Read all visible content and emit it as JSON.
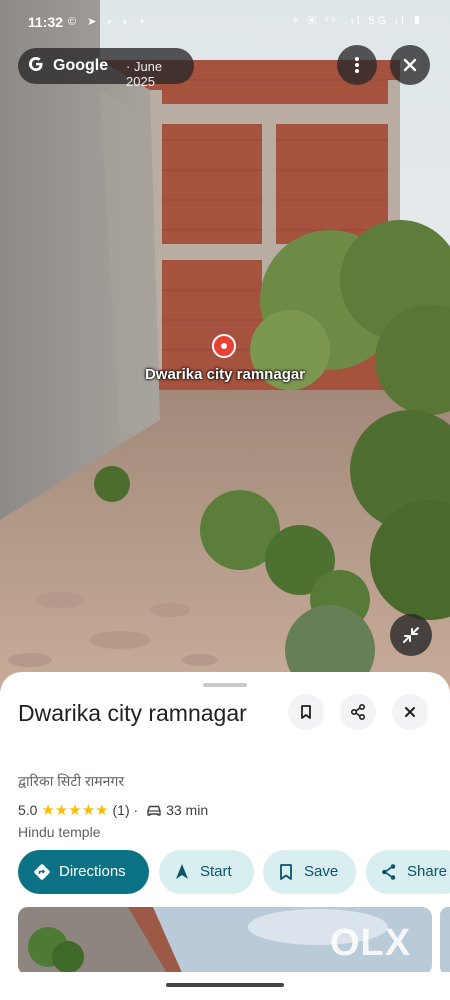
{
  "status_bar": {
    "time": "11:32",
    "left_icons": "© ➤ ▪ ◐ •",
    "right_icons": "⌖ ▣ ᵛᵒ .ıl 5G ıl ▮"
  },
  "streetview": {
    "brand": "Google",
    "date": " · June 2025",
    "place_label": "Dwarika city ramnagar",
    "buttons": {
      "more": "more-options",
      "close": "close"
    }
  },
  "place": {
    "name": "Dwarika city ramnagar",
    "local_name": "द्वारिका सिटी रामनगर",
    "rating": "5.0",
    "stars": "★★★★★",
    "review_count": "(1)",
    "separator": " · ",
    "drive_time": "33 min",
    "category": "Hindu temple"
  },
  "actions": {
    "directions": "Directions",
    "start": "Start",
    "save": "Save",
    "share": "Share"
  },
  "watermark": "OLX",
  "colors": {
    "accent": "#0b7285",
    "chip": "#d8eef1",
    "star": "#fbbc04",
    "pin": "#e94235"
  }
}
